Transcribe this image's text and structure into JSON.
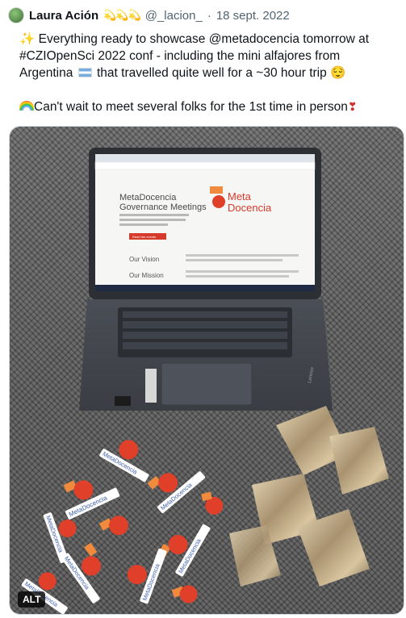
{
  "tweet": {
    "author_name": "Laura Ación",
    "author_emojis": "💫💫💫",
    "handle": "@_lacion_",
    "separator": "·",
    "date": "18 sept. 2022",
    "line1_emoji": "✨",
    "line1_text": " Everything ready to showcase @metadocencia tomorrow at",
    "line2_text": "#CZIOpenSci 2022 conf - including the mini alfajores from",
    "line3_pre": "Argentina ",
    "line3_post": " that travelled quite well for a ~30 hour trip ",
    "line3_emoji": "😌",
    "line4_text": "Can't wait to meet several folks for the 1st time in person",
    "line4_emoji": "❣"
  },
  "photo": {
    "screen": {
      "title_line1": "MetaDocencia",
      "title_line2": "Governance Meetings",
      "description": "Participate in the conversations that will guide the learning process to collaboratively build our form of government.",
      "button_label": "Read the events",
      "logo_line1": "Meta",
      "logo_line2": "Docencia",
      "vision_label": "Our Vision",
      "mission_label": "Our Mission"
    },
    "laptop_brand": "Lenovo",
    "sticker_text": "MetaDocencia"
  },
  "alt_badge": "ALT",
  "colors": {
    "accent_red": "#e0402a",
    "accent_orange": "#f08a3c",
    "sticker_blue": "#3b5ea8"
  }
}
